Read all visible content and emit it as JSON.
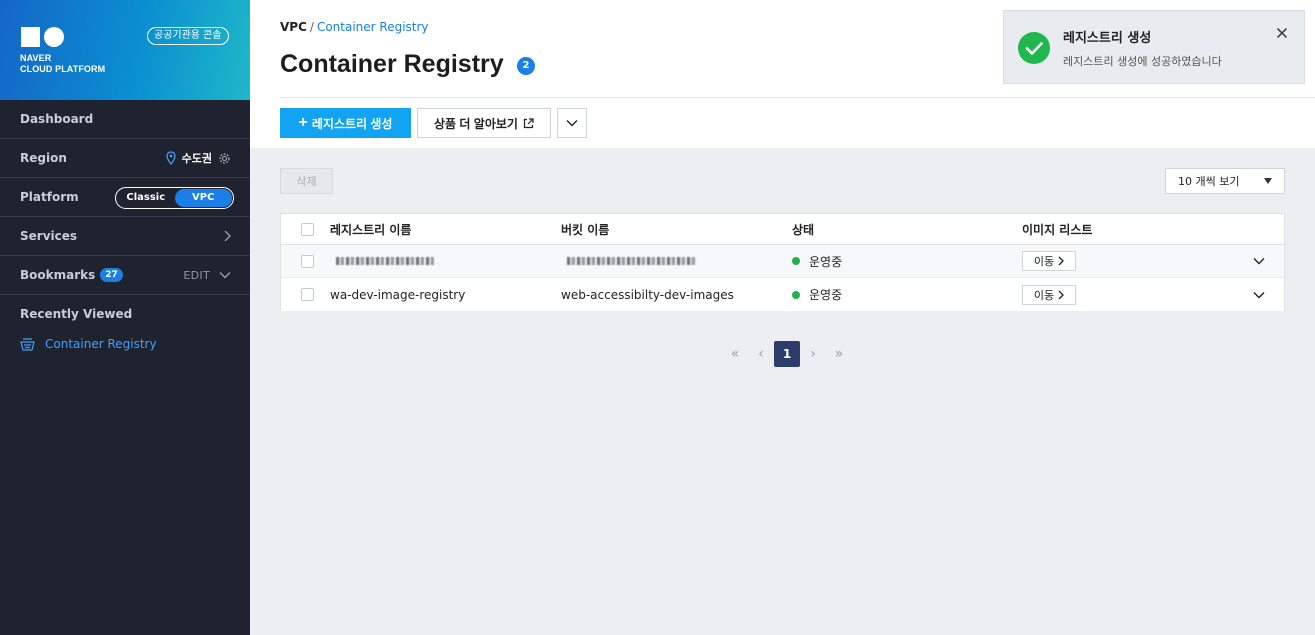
{
  "sidebar": {
    "logo_line1": "NAVER",
    "logo_line2": "CLOUD PLATFORM",
    "gov_badge": "공공기관용 콘솔",
    "dashboard": "Dashboard",
    "region_label": "Region",
    "region_value": "수도권",
    "platform_label": "Platform",
    "platform_options": [
      "Classic",
      "VPC"
    ],
    "platform_selected": "VPC",
    "services_label": "Services",
    "bookmarks_label": "Bookmarks",
    "bookmarks_count": "27",
    "bookmarks_edit": "EDIT",
    "recently_viewed": "Recently Viewed",
    "recent_items": [
      {
        "label": "Container Registry",
        "icon": "registry-icon"
      }
    ]
  },
  "breadcrumb": {
    "root": "VPC",
    "separator": "/",
    "current": "Container Registry"
  },
  "page": {
    "title": "Container Registry",
    "count": "2"
  },
  "toolbar": {
    "create_label": "레지스트리 생성",
    "learn_more_label": "상품 더 알아보기",
    "delete_label": "삭제",
    "page_size": "10 개씩 보기"
  },
  "table": {
    "headers": [
      "레지스트리 이름",
      "버킷 이름",
      "상태",
      "이미지 리스트"
    ],
    "rows": [
      {
        "name": "",
        "bucket": "",
        "status": "운영중",
        "images": "이동",
        "redacted": true
      },
      {
        "name": "wa-dev-image-registry",
        "bucket": "web-accessibilty-dev-images",
        "status": "운영중",
        "images": "이동",
        "redacted": false
      }
    ]
  },
  "pagination": {
    "current": "1"
  },
  "toast": {
    "title": "레지스트리 생성",
    "message": "레지스트리 생성에 성공하였습니다"
  },
  "colors": {
    "accent": "#1a7fe6",
    "create_button": "#12a3f2",
    "success": "#1fb84e",
    "sidebar_bg": "#1f2330"
  }
}
